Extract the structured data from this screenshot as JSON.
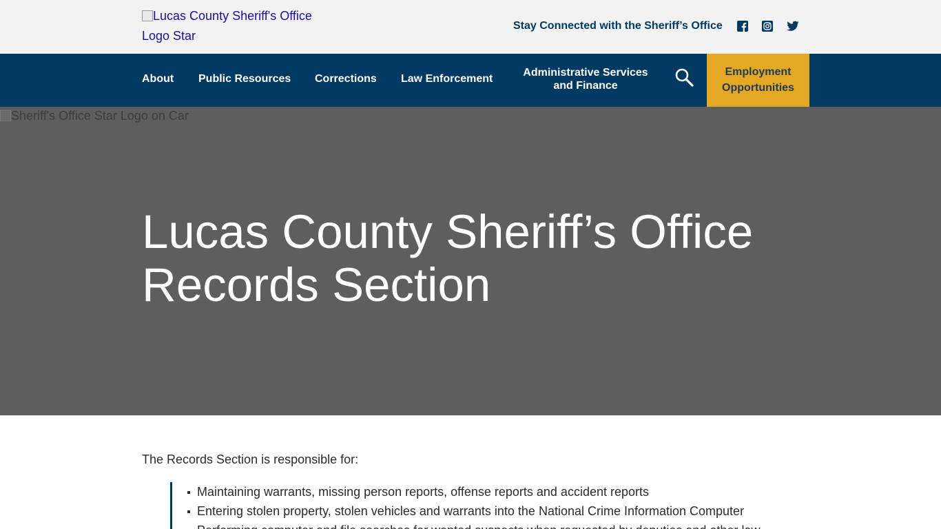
{
  "header": {
    "logo_alt": "Lucas County Sheriff's Office Logo Star",
    "stay_connected": "Stay Connected with the Sheriff’s Office",
    "social": [
      {
        "icon": "facebook-icon"
      },
      {
        "icon": "instagram-icon"
      },
      {
        "icon": "twitter-icon"
      }
    ]
  },
  "nav": {
    "items": [
      {
        "label": "About"
      },
      {
        "label": "Public Resources"
      },
      {
        "label": "Corrections"
      },
      {
        "label": "Law Enforcement"
      },
      {
        "label": "Administrative Services and Finance"
      }
    ],
    "search_icon": "search-icon",
    "employment": "Employment Opportunities"
  },
  "hero": {
    "image_alt": "Sheriff's Office Star Logo on Car",
    "title_line1": "Lucas County Sheriff’s Office",
    "title_line2": "Records Section"
  },
  "content": {
    "intro": "The Records Section is responsible for:",
    "list": [
      "Maintaining warrants, missing person reports, offense reports and accident reports",
      "Entering stolen property, stolen vehicles and warrants into the National Crime Information Computer",
      "Performing computer and file searches for wanted suspects when requested by deputies and other law"
    ]
  },
  "colors": {
    "navy": "#003a63",
    "gold": "#e5a823",
    "hero_gray": "#5e5e5e",
    "topbar": "#f2f2f2"
  }
}
